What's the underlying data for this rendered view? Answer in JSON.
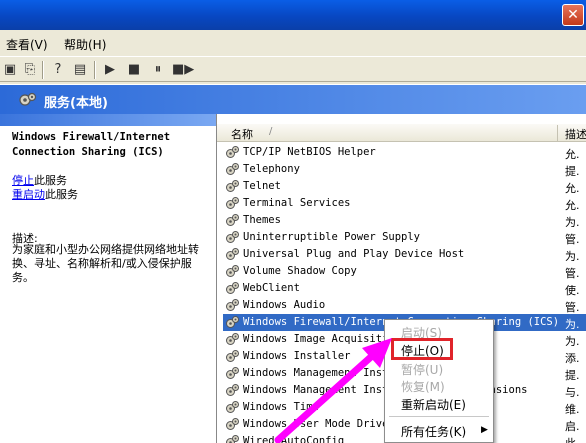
{
  "menubar": {
    "items": [
      {
        "label": "查看(V)"
      },
      {
        "label": "帮助(H)"
      }
    ]
  },
  "toolbar": {
    "icons": [
      "console-tree-icon",
      "export-list-icon",
      "help-icon",
      "properties-icon",
      "start-icon",
      "stop-icon",
      "pause-icon",
      "restart-icon"
    ]
  },
  "header": {
    "title": "服务(本地)"
  },
  "left_pane": {
    "service_name": "Windows Firewall/Internet Connection Sharing (ICS)",
    "stop_link": "停止",
    "stop_suffix": "此服务",
    "restart_link": "重启动",
    "restart_suffix": "此服务",
    "desc_label": "描述:",
    "description": "为家庭和小型办公网络提供网络地址转换、寻址、名称解析和/或入侵保护服务。"
  },
  "list": {
    "col_name": "名称",
    "col_sort": "/",
    "col_desc": "描述",
    "rows": [
      {
        "name": "TCP/IP NetBIOS Helper",
        "desc": "允."
      },
      {
        "name": "Telephony",
        "desc": "提."
      },
      {
        "name": "Telnet",
        "desc": "允."
      },
      {
        "name": "Terminal Services",
        "desc": "允."
      },
      {
        "name": "Themes",
        "desc": "为."
      },
      {
        "name": "Uninterruptible Power Supply",
        "desc": "管."
      },
      {
        "name": "Universal Plug and Play Device Host",
        "desc": "为."
      },
      {
        "name": "Volume Shadow Copy",
        "desc": "管."
      },
      {
        "name": "WebClient",
        "desc": "使."
      },
      {
        "name": "Windows Audio",
        "desc": "管."
      },
      {
        "name": "Windows Firewall/Internet Connection Sharing (ICS)",
        "desc": "为."
      },
      {
        "name": "Windows Image Acquisition",
        "desc": "为."
      },
      {
        "name": "Windows Installer",
        "desc": "添."
      },
      {
        "name": "Windows Management Instrumentation",
        "desc": "提."
      },
      {
        "name": "Windows Management Instrumentation Extensions",
        "desc": "与."
      },
      {
        "name": "Windows Time",
        "desc": "维."
      },
      {
        "name": "Windows User Mode Driver Framework",
        "desc": "启."
      },
      {
        "name": "Wired AutoConfig",
        "desc": "此."
      }
    ],
    "selected_index": 10
  },
  "context_menu": {
    "items": [
      {
        "label": "启动(S)",
        "disabled": true
      },
      {
        "label": "停止(O)",
        "disabled": false
      },
      {
        "label": "暂停(U)",
        "disabled": true
      },
      {
        "label": "恢复(M)",
        "disabled": true
      },
      {
        "label": "重新启动(E)",
        "disabled": false
      },
      {
        "label": "所有任务(K)",
        "disabled": false
      }
    ]
  },
  "colors": {
    "selection": "#316ac5",
    "highlight_box": "#e0242a",
    "annotation_arrow": "#ff00ff"
  }
}
